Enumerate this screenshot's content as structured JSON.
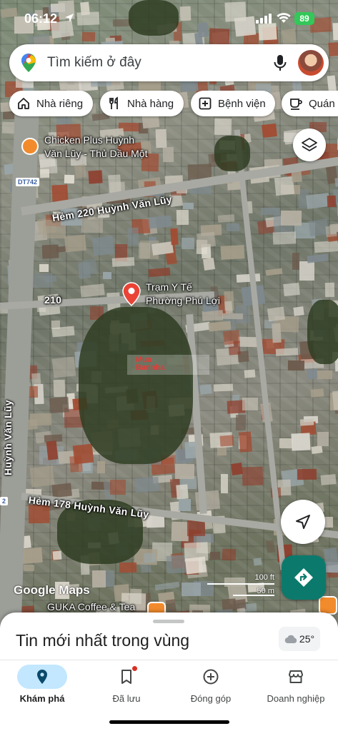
{
  "status_bar": {
    "time": "06:12",
    "battery": "89"
  },
  "search": {
    "placeholder": "Tìm kiếm ở đây"
  },
  "chips": [
    {
      "label": "Nhà riêng",
      "icon": "home-icon"
    },
    {
      "label": "Nhà hàng",
      "icon": "restaurant-icon"
    },
    {
      "label": "Bệnh viện",
      "icon": "hospital-icon"
    },
    {
      "label": "Quán c",
      "icon": "cafe-icon"
    }
  ],
  "map": {
    "places": {
      "chicken": "Chicken Plus Huỳnh\nVăn Lũy - Thủ Dầu Một",
      "health": "Trạm Y Tế\nPhường Phú Lợi",
      "cafe": "GUKA Coffee & Tea"
    },
    "roads": {
      "hem220": "Hẻm 220 Huỳnh Văn Lũy",
      "hem178": "Hẻm 178 Huỳnh Văn Lũy",
      "main": "Huỳnh Văn Lũy",
      "r210": "210"
    },
    "shield": "DT742",
    "shield2": "2",
    "attribution": "Google Maps",
    "scale": {
      "imperial": "100 ft",
      "metric": "50 m"
    },
    "watermark": "Mua\nBannha"
  },
  "sheet": {
    "title": "Tin mới nhất trong vùng",
    "weather": "25°"
  },
  "nav": [
    {
      "label": "Khám phá",
      "icon": "explore-pin-icon",
      "active": true
    },
    {
      "label": "Đã lưu",
      "icon": "bookmark-icon",
      "active": false
    },
    {
      "label": "Đóng góp",
      "icon": "add-circle-icon",
      "active": false
    },
    {
      "label": "Doanh nghiệp",
      "icon": "storefront-icon",
      "active": false
    }
  ],
  "colors": {
    "accent": "#0b7a6c",
    "nav_active_pill": "#c2e7ff",
    "marker_red": "#ea4335",
    "poi_orange": "#f28b2c"
  }
}
